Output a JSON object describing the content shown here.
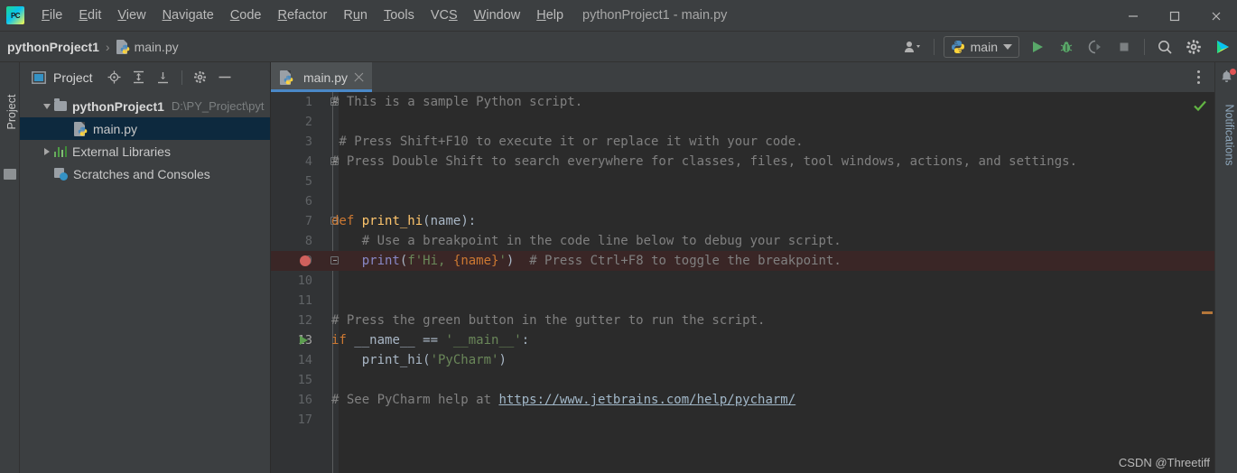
{
  "window": {
    "title": "pythonProject1 - main.py",
    "logo_text": "PC",
    "controls": {
      "minimize": "minimize-icon",
      "maximize": "maximize-icon",
      "close": "close-icon"
    }
  },
  "menu": {
    "items": [
      {
        "label": "File",
        "mnemonic": "F",
        "rest": "ile"
      },
      {
        "label": "Edit",
        "mnemonic": "E",
        "rest": "dit"
      },
      {
        "label": "View",
        "mnemonic": "V",
        "rest": "iew"
      },
      {
        "label": "Navigate",
        "mnemonic": "N",
        "rest": "avigate"
      },
      {
        "label": "Code",
        "mnemonic": "C",
        "rest": "ode"
      },
      {
        "label": "Refactor",
        "mnemonic": "R",
        "rest": "efactor"
      },
      {
        "label": "Run",
        "mnemonic": "R",
        "rest": "un",
        "pre": "R",
        "mid": "u",
        "post": "n"
      },
      {
        "label": "Tools",
        "mnemonic": "T",
        "rest": "ools"
      },
      {
        "label": "VCS",
        "mnemonic": "S",
        "rest": "VCS"
      },
      {
        "label": "Window",
        "mnemonic": "W",
        "rest": "indow"
      },
      {
        "label": "Help",
        "mnemonic": "H",
        "rest": "elp"
      }
    ]
  },
  "navbar": {
    "project_crumb": "pythonProject1",
    "separator": "›",
    "file_crumb": "main.py",
    "run_config": "main",
    "toolbar_icons": [
      "user-accounts-icon",
      "run-icon",
      "debug-icon",
      "run-with-coverage-icon",
      "stop-icon",
      "search-everywhere-icon",
      "settings-gear-icon",
      "updates-icon"
    ]
  },
  "left_strip": {
    "label": "Project",
    "structure_icon": "structure-icon"
  },
  "project_panel": {
    "title": "Project",
    "tools": [
      "locate-icon",
      "expand-all-icon",
      "collapse-all-icon",
      "settings-gear-icon",
      "hide-icon"
    ],
    "tree": [
      {
        "name": "pythonProject1",
        "path": "D:\\PY_Project\\pyt",
        "type": "folder",
        "expanded": true,
        "depth": 0,
        "selected": false
      },
      {
        "name": "main.py",
        "path": "",
        "type": "python-file",
        "expanded": false,
        "depth": 1,
        "selected": true
      },
      {
        "name": "External Libraries",
        "path": "",
        "type": "libraries",
        "expanded": false,
        "depth": 0,
        "selected": false
      },
      {
        "name": "Scratches and Consoles",
        "path": "",
        "type": "scratches",
        "expanded": false,
        "depth": 0,
        "selected": false
      }
    ]
  },
  "editor": {
    "tabs": [
      {
        "label": "main.py",
        "icon": "python-file-icon",
        "active": true,
        "close": "close-icon"
      }
    ],
    "options_icon": "more-options-icon",
    "inspection_status": "checkmark-ok-icon",
    "lines": [
      {
        "n": "1",
        "fold": true,
        "gutter": "",
        "html": "<span class='cm'># This is a sample Python script.</span>"
      },
      {
        "n": "2",
        "fold": false,
        "gutter": "",
        "html": ""
      },
      {
        "n": "3",
        "fold": false,
        "gutter": "",
        "html": "<span class='cm'> # Press Shift+F10 to execute it or replace it with your code.</span>"
      },
      {
        "n": "4",
        "fold": true,
        "gutter": "",
        "html": "<span class='cm'># Press Double Shift to search everywhere for classes, files, tool windows, actions, and settings.</span>"
      },
      {
        "n": "5",
        "fold": false,
        "gutter": "",
        "html": ""
      },
      {
        "n": "6",
        "fold": false,
        "gutter": "",
        "html": ""
      },
      {
        "n": "7",
        "fold": true,
        "gutter": "",
        "html": "<span class='kw'>def</span> <span class='fn'>print_hi</span><span class='id'>(name):</span>"
      },
      {
        "n": "8",
        "fold": false,
        "gutter": "",
        "html": "    <span class='cm'># Use a breakpoint in the code line below to debug your script.</span>"
      },
      {
        "n": "9",
        "fold": true,
        "gutter": "breakpoint",
        "highlight": true,
        "html": "    <span class='pf'>print</span><span class='id'>(</span><span class='st'>f'Hi, </span><span class='ph'>{name}</span><span class='st'>'</span><span class='id'>)</span>  <span class='cm'># Press Ctrl+F8 to toggle the breakpoint.</span>"
      },
      {
        "n": "10",
        "fold": false,
        "gutter": "",
        "html": ""
      },
      {
        "n": "11",
        "fold": false,
        "gutter": "",
        "html": ""
      },
      {
        "n": "12",
        "fold": false,
        "gutter": "",
        "html": "<span class='cm'># Press the green button in the gutter to run the script.</span>"
      },
      {
        "n": "13",
        "fold": false,
        "gutter": "run",
        "active": true,
        "html": "<span class='kw'>if</span> <span class='id'>__name__ == </span><span class='st'>'__main__'</span><span class='id'>:</span>"
      },
      {
        "n": "14",
        "fold": false,
        "gutter": "",
        "html": "    <span class='id'>print_hi(</span><span class='st'>'PyCharm'</span><span class='id'>)</span>"
      },
      {
        "n": "15",
        "fold": false,
        "gutter": "",
        "html": ""
      },
      {
        "n": "16",
        "fold": false,
        "gutter": "",
        "html": "<span class='cm'># See PyCharm help at </span><span class='lnk2'>https://www.jetbrains.com/help/pycharm/</span>"
      },
      {
        "n": "17",
        "fold": false,
        "gutter": "",
        "html": ""
      }
    ]
  },
  "right_strip": {
    "label": "Notifications",
    "icon": "notifications-bell-icon",
    "has_badge": true
  },
  "watermark": "CSDN @Threetiff",
  "colors": {
    "bg_chrome": "#3c3f41",
    "bg_editor": "#2b2b2b",
    "bg_gutter": "#313335",
    "accent_tab": "#4a88c7",
    "selection": "#0d293e",
    "breakpoint": "#d1615d",
    "breakpoint_row": "#3a2626",
    "run_green": "#5c9e4f",
    "keyword": "#cc7832",
    "string": "#6a8759",
    "function": "#ffc66d",
    "comment": "#808080",
    "text": "#a9b7c6"
  }
}
